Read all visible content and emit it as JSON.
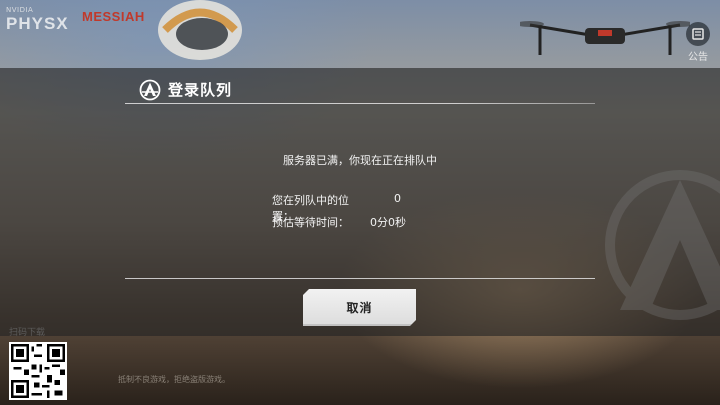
{
  "brand": {
    "nvidia": "NVIDIA",
    "physx": "PHYSX",
    "messiah": "MESSIAH"
  },
  "notice_label": "公告",
  "qr_caption": "扫码下载",
  "footer_text": "抵制不良游戏，拒绝盗版游戏。",
  "dialog": {
    "title": "登录队列",
    "main_message": "服务器已满，你现在正在排队中",
    "position_label": "您在列队中的位置：",
    "position_value": "0",
    "wait_label": "预估等待时间：",
    "wait_value": "0分0秒",
    "cancel_label": "取消"
  },
  "colors": {
    "overlay": "#232323",
    "title_text": "#ffffff",
    "button_bg": "#e6e6e6",
    "messiah_red": "#c0392b"
  }
}
